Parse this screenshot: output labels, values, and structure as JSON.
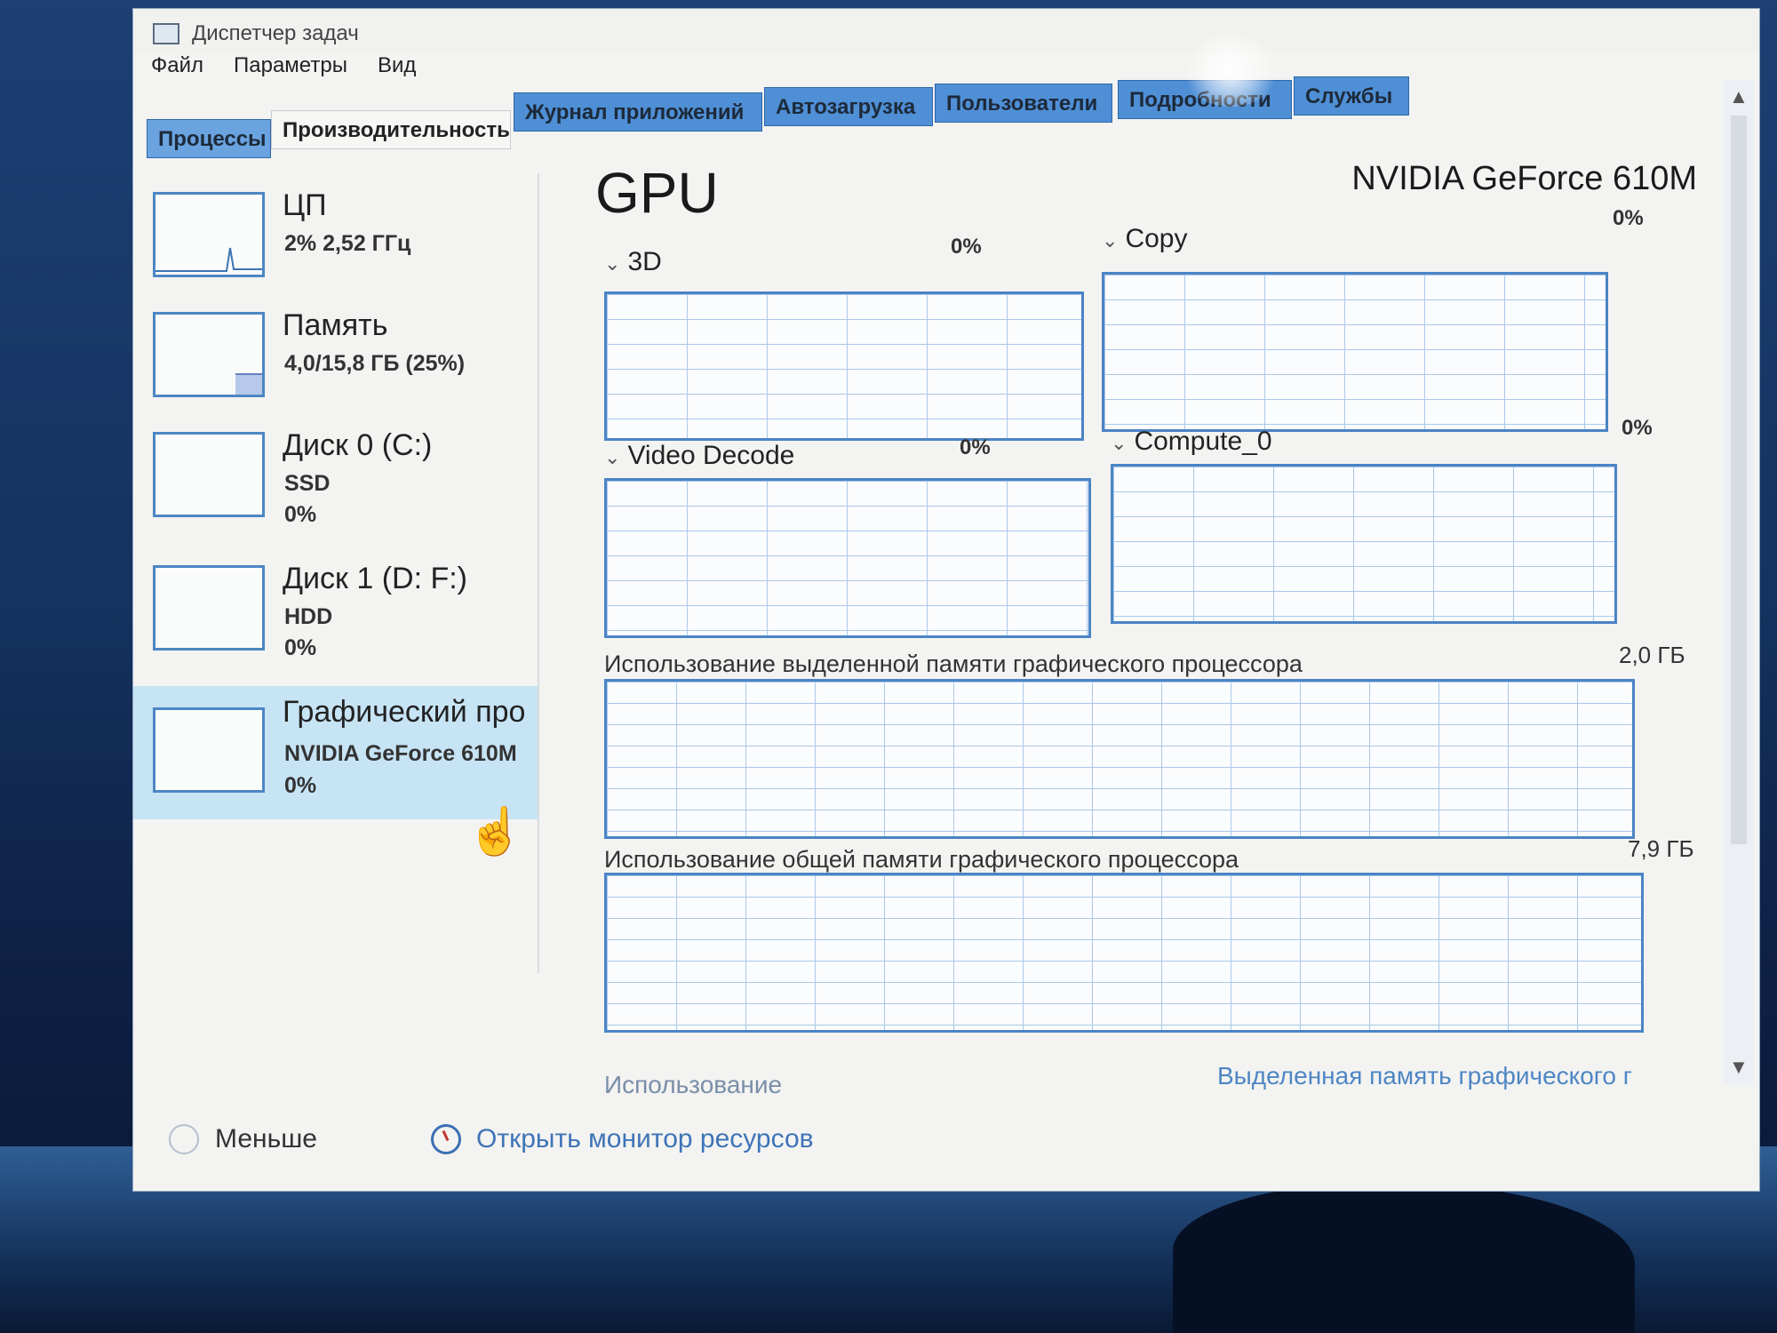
{
  "window": {
    "title": "Диспетчер задач"
  },
  "menu": {
    "items": [
      "Файл",
      "Параметры",
      "Вид"
    ]
  },
  "tabs": [
    {
      "label": "Процессы",
      "active": false
    },
    {
      "label": "Производительность",
      "active": true
    },
    {
      "label": "Журнал приложений",
      "active": false
    },
    {
      "label": "Автозагрузка",
      "active": false
    },
    {
      "label": "Пользователи",
      "active": false
    },
    {
      "label": "Подробности",
      "active": false
    },
    {
      "label": "Службы",
      "active": false
    }
  ],
  "sidebar": {
    "items": [
      {
        "title": "ЦП",
        "line1": "2% 2,52 ГГц",
        "line2": ""
      },
      {
        "title": "Память",
        "line1": "4,0/15,8 ГБ (25%)",
        "line2": ""
      },
      {
        "title": "Диск 0 (C:)",
        "line1": "SSD",
        "line2": "0%"
      },
      {
        "title": "Диск 1 (D: F:)",
        "line1": "HDD",
        "line2": "0%"
      },
      {
        "title": "Графический про",
        "line1": "NVIDIA GeForce 610M",
        "line2": "0%",
        "selected": true
      }
    ]
  },
  "main": {
    "title": "GPU",
    "model": "NVIDIA GeForce 610M",
    "engines": [
      {
        "name": "3D",
        "percent": "0%"
      },
      {
        "name": "Copy",
        "percent": "0%"
      },
      {
        "name": "Video Decode",
        "percent": "0%"
      },
      {
        "name": "Compute_0",
        "percent": "0%"
      }
    ],
    "dedicated_memory": {
      "label": "Использование выделенной памяти графического процессора",
      "max": "2,0 ГБ"
    },
    "shared_memory": {
      "label": "Использование общей памяти графического процессора",
      "max": "7,9 ГБ"
    },
    "footer": {
      "utilization_label": "Использование",
      "dedicated_label": "Выделенная память графического г"
    }
  },
  "bottom": {
    "less_label": "Меньше",
    "monitor_label": "Открыть монитор ресурсов"
  },
  "colors": {
    "accent": "#4b84c6",
    "tab_blue": "#4f8fd6",
    "selected_bg": "#c7e4f5",
    "link": "#3f74b8"
  }
}
